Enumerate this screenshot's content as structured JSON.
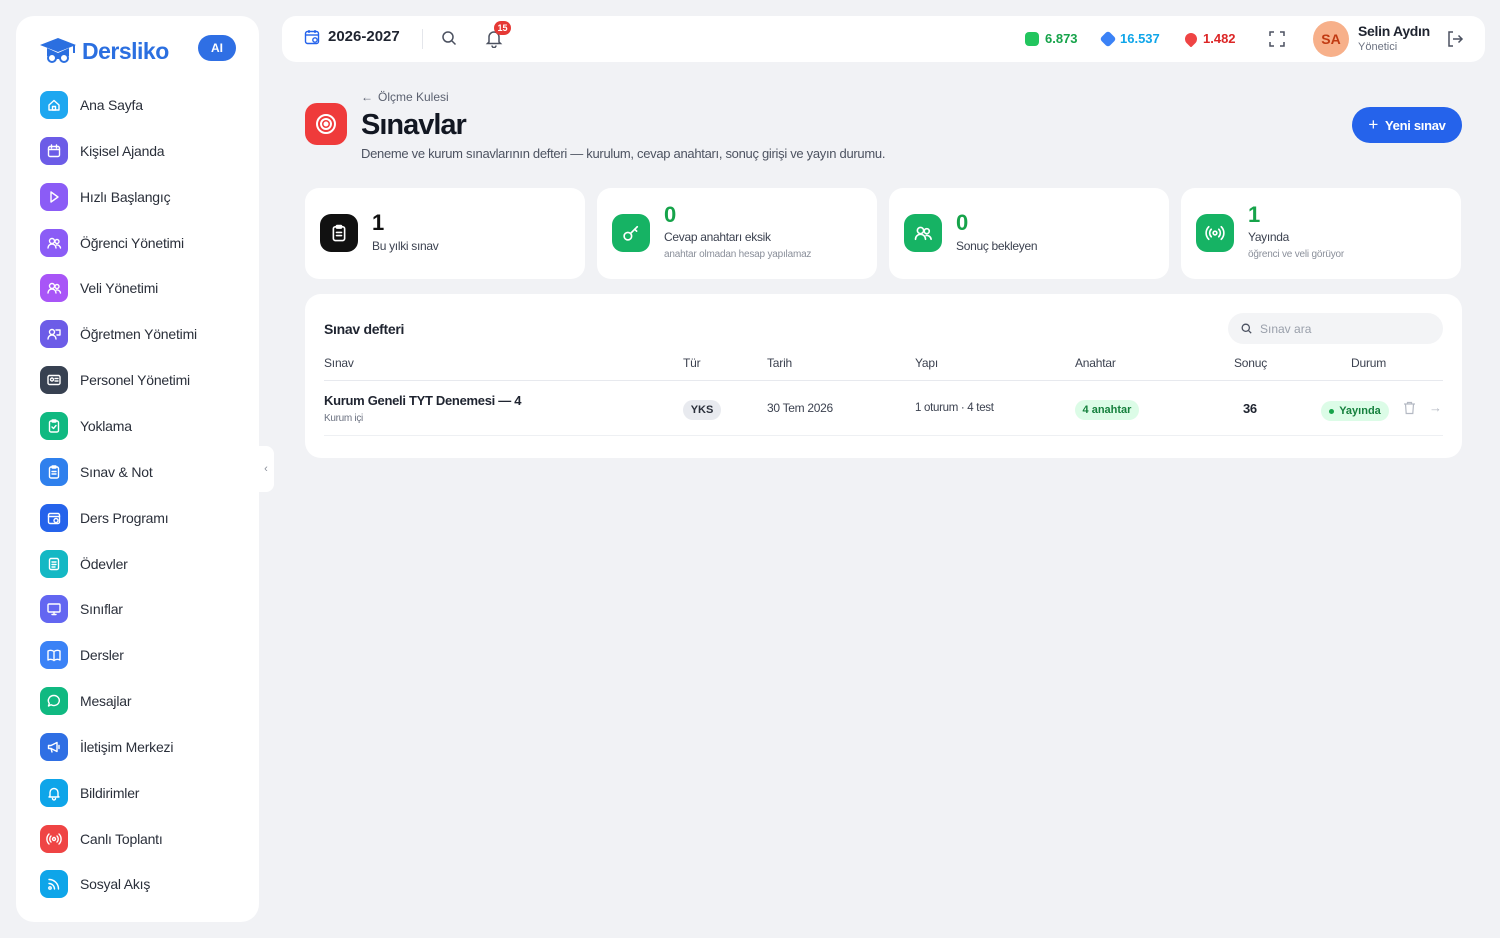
{
  "app": {
    "brand": "Dersliko",
    "ai_badge": "AI"
  },
  "sidebar": {
    "items": [
      {
        "label": "Ana Sayfa",
        "icon": "home-icon",
        "color": "#1ea7f0"
      },
      {
        "label": "Kişisel Ajanda",
        "icon": "calendar-icon",
        "color": "#6c5ce7"
      },
      {
        "label": "Hızlı Başlangıç",
        "icon": "play-icon",
        "color": "#8b5cf6"
      },
      {
        "label": "Öğrenci Yönetimi",
        "icon": "users-icon",
        "color": "#8b5cf6"
      },
      {
        "label": "Veli Yönetimi",
        "icon": "users-icon",
        "color": "#a855f7"
      },
      {
        "label": "Öğretmen Yönetimi",
        "icon": "teacher-icon",
        "color": "#6c5ce7"
      },
      {
        "label": "Personel Yönetimi",
        "icon": "id-card-icon",
        "color": "#374151"
      },
      {
        "label": "Yoklama",
        "icon": "clipboard-check-icon",
        "color": "#10b981"
      },
      {
        "label": "Sınav & Not",
        "icon": "clipboard-icon",
        "color": "#2f80ed"
      },
      {
        "label": "Ders Programı",
        "icon": "calendar-clock-icon",
        "color": "#2563eb"
      },
      {
        "label": "Ödevler",
        "icon": "list-icon",
        "color": "#14b8c4"
      },
      {
        "label": "Sınıflar",
        "icon": "monitor-icon",
        "color": "#6366f1"
      },
      {
        "label": "Dersler",
        "icon": "book-icon",
        "color": "#3b82f6"
      },
      {
        "label": "Mesajlar",
        "icon": "message-icon",
        "color": "#10b981"
      },
      {
        "label": "İletişim Merkezi",
        "icon": "megaphone-icon",
        "color": "#2f6fe4"
      },
      {
        "label": "Bildirimler",
        "icon": "bell-icon",
        "color": "#0ea5e9"
      },
      {
        "label": "Canlı Toplantı",
        "icon": "broadcast-icon",
        "color": "#ef4444"
      },
      {
        "label": "Sosyal Akış",
        "icon": "rss-icon",
        "color": "#0ea5e9"
      }
    ]
  },
  "topbar": {
    "year": "2026-2027",
    "notification_count": "15",
    "stats": [
      {
        "value": "6.873",
        "icon": "green-gem-icon",
        "color": "#16a34a"
      },
      {
        "value": "16.537",
        "icon": "blue-gem-icon",
        "color": "#0ea5e9"
      },
      {
        "value": "1.482",
        "icon": "fire-icon",
        "color": "#dc2626"
      }
    ],
    "user": {
      "initials": "SA",
      "name": "Selin Aydın",
      "role": "Yönetici"
    }
  },
  "header": {
    "back_label": "Ölçme Kulesi",
    "title": "Sınavlar",
    "subtitle": "Deneme ve kurum sınavlarının defteri — kurulum, cevap anahtarı, sonuç girişi ve yayın durumu.",
    "new_button": "Yeni sınav"
  },
  "cards": [
    {
      "value": "1",
      "label": "Bu yılki sınav",
      "hint": "",
      "color": "#111111",
      "num_color": "#111111",
      "icon": "clipboard-icon"
    },
    {
      "value": "0",
      "label": "Cevap anahtarı eksik",
      "hint": "anahtar olmadan hesap yapılamaz",
      "color": "#16b364",
      "num_color": "#16a34a",
      "icon": "key-icon"
    },
    {
      "value": "0",
      "label": "Sonuç bekleyen",
      "hint": "",
      "color": "#16b364",
      "num_color": "#16a34a",
      "icon": "users-icon"
    },
    {
      "value": "1",
      "label": "Yayında",
      "hint": "öğrenci ve veli görüyor",
      "color": "#16b364",
      "num_color": "#16a34a",
      "icon": "broadcast-icon"
    }
  ],
  "table": {
    "title": "Sınav defteri",
    "search_placeholder": "Sınav ara",
    "columns": [
      "Sınav",
      "Tür",
      "Tarih",
      "Yapı",
      "Anahtar",
      "Sonuç",
      "Durum"
    ],
    "rows": [
      {
        "name": "Kurum Geneli TYT Denemesi — 4",
        "scope": "Kurum içi",
        "type": "YKS",
        "date": "30 Tem 2026",
        "structure": "1 oturum · 4 test",
        "key": "4 anahtar",
        "result": "36",
        "status": "Yayında"
      }
    ]
  }
}
